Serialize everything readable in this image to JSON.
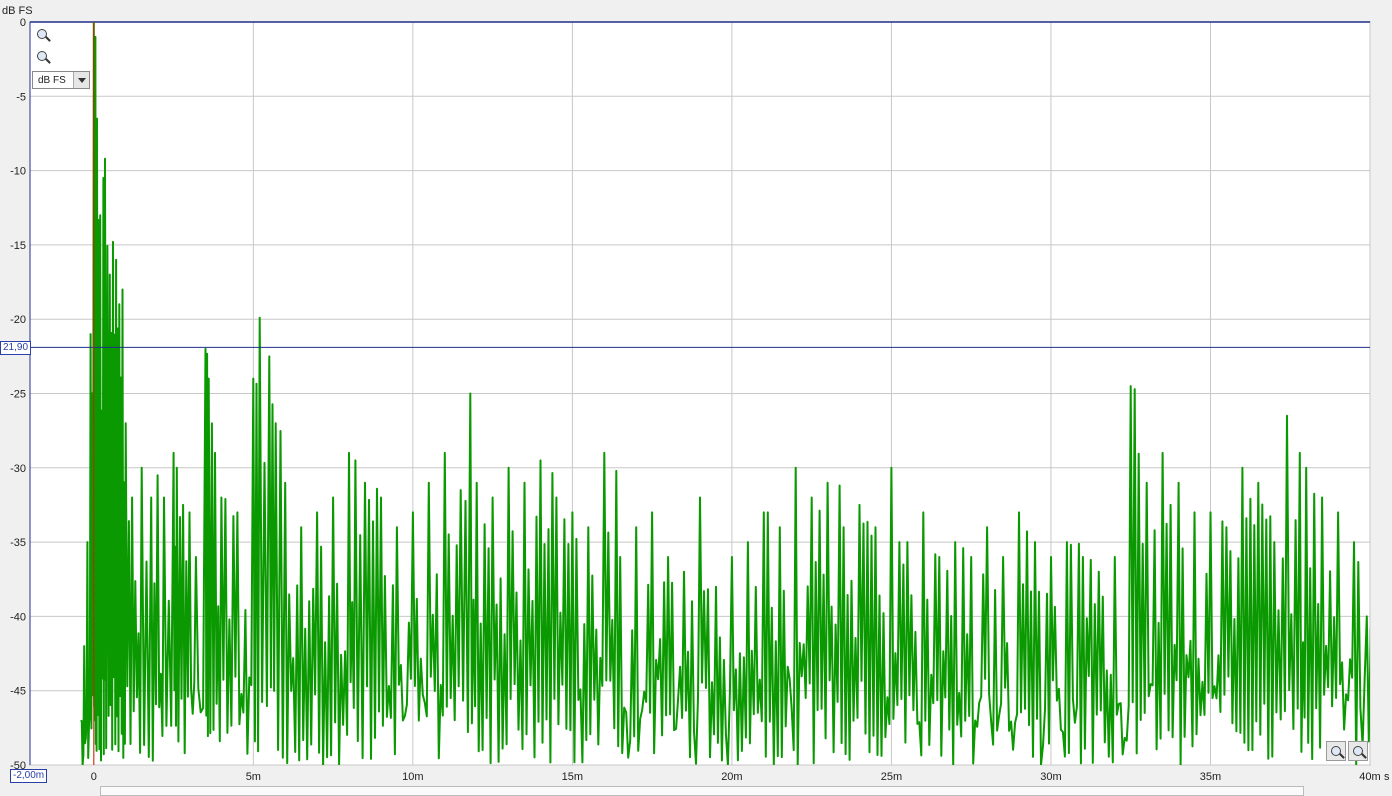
{
  "y_unit_label": "dB FS",
  "x_unit_label": "s",
  "unit_select": {
    "value": "dB FS"
  },
  "cursor": {
    "y_value": "21,90",
    "x_value": "-2,00m"
  },
  "colors": {
    "trace": "#0a9900",
    "grid": "#c8c8c8",
    "cursor": "#1f2f8c",
    "marker": "#cc2200",
    "background": "#ffffff"
  },
  "icons": {
    "zoom_in": "zoom-in-icon",
    "zoom_out": "zoom-out-icon"
  },
  "chart_data": {
    "type": "line",
    "xlabel": "s",
    "ylabel": "dB FS",
    "xlim": [
      -0.002,
      0.04
    ],
    "ylim": [
      -50,
      0
    ],
    "grid": true,
    "x_ticks": [
      "0",
      "5m",
      "10m",
      "15m",
      "20m",
      "25m",
      "30m",
      "35m",
      "40m"
    ],
    "y_ticks": [
      "0",
      "-5",
      "-10",
      "-15",
      "-20",
      "-25",
      "-30",
      "-35",
      "-40",
      "-45",
      "-50"
    ],
    "cursor_level": -21.9,
    "marker_x": 0.0,
    "series": [
      {
        "peaks": [
          [
            -0.0004,
            -47
          ],
          [
            -0.0003,
            -42
          ],
          [
            -0.0002,
            -35
          ],
          [
            -0.0001,
            -21
          ],
          [
            0.0,
            0
          ],
          [
            5e-05,
            -1
          ],
          [
            0.0001,
            -6.5
          ],
          [
            0.0002,
            -13
          ],
          [
            0.0003,
            -10.5
          ],
          [
            0.00035,
            -9.2
          ],
          [
            0.0005,
            -17
          ],
          [
            0.0006,
            -14.8
          ],
          [
            0.0007,
            -16
          ],
          [
            0.0008,
            -19
          ],
          [
            0.0009,
            -18
          ],
          [
            0.001,
            -27
          ],
          [
            0.0012,
            -32
          ],
          [
            0.0015,
            -30
          ],
          [
            0.0018,
            -32
          ],
          [
            0.002,
            -30.5
          ],
          [
            0.0022,
            -32
          ],
          [
            0.0025,
            -29
          ],
          [
            0.0026,
            -30
          ],
          [
            0.0028,
            -32.5
          ],
          [
            0.003,
            -33
          ],
          [
            0.0032,
            -36
          ],
          [
            0.0035,
            -22
          ],
          [
            0.0036,
            -24
          ],
          [
            0.0038,
            -29
          ],
          [
            0.004,
            -32
          ],
          [
            0.0045,
            -33
          ],
          [
            0.005,
            -24
          ],
          [
            0.0052,
            -19.9
          ],
          [
            0.0055,
            -22.5
          ],
          [
            0.0057,
            -27
          ],
          [
            0.006,
            -31
          ],
          [
            0.0065,
            -34
          ],
          [
            0.007,
            -33
          ],
          [
            0.0075,
            -32
          ],
          [
            0.008,
            -29
          ],
          [
            0.0082,
            -29.5
          ],
          [
            0.0085,
            -31
          ],
          [
            0.009,
            -32
          ],
          [
            0.0095,
            -34
          ],
          [
            0.01,
            -33
          ],
          [
            0.0105,
            -31
          ],
          [
            0.011,
            -29
          ],
          [
            0.0115,
            -31.5
          ],
          [
            0.0118,
            -25
          ],
          [
            0.012,
            -31
          ],
          [
            0.0125,
            -32
          ],
          [
            0.013,
            -30
          ],
          [
            0.0135,
            -31
          ],
          [
            0.014,
            -29.5
          ],
          [
            0.0145,
            -32
          ],
          [
            0.015,
            -33
          ],
          [
            0.0155,
            -34
          ],
          [
            0.016,
            -29
          ],
          [
            0.0165,
            -36
          ],
          [
            0.017,
            -34
          ],
          [
            0.0175,
            -33
          ],
          [
            0.018,
            -36
          ],
          [
            0.0185,
            -37
          ],
          [
            0.019,
            -32
          ],
          [
            0.0195,
            -38
          ],
          [
            0.02,
            -36
          ],
          [
            0.0205,
            -35
          ],
          [
            0.021,
            -33
          ],
          [
            0.0215,
            -34
          ],
          [
            0.022,
            -30
          ],
          [
            0.0225,
            -32
          ],
          [
            0.023,
            -31
          ],
          [
            0.0235,
            -34
          ],
          [
            0.024,
            -32.5
          ],
          [
            0.0245,
            -34
          ],
          [
            0.025,
            -30
          ],
          [
            0.0255,
            -35
          ],
          [
            0.026,
            -33
          ],
          [
            0.0265,
            -36
          ],
          [
            0.027,
            -35
          ],
          [
            0.0275,
            -36
          ],
          [
            0.028,
            -34
          ],
          [
            0.0285,
            -36
          ],
          [
            0.029,
            -33
          ],
          [
            0.0295,
            -35
          ],
          [
            0.03,
            -36
          ],
          [
            0.0305,
            -35
          ],
          [
            0.031,
            -36
          ],
          [
            0.0315,
            -37
          ],
          [
            0.032,
            -36
          ],
          [
            0.0325,
            -24.5
          ],
          [
            0.033,
            -31
          ],
          [
            0.0335,
            -29
          ],
          [
            0.034,
            -31
          ],
          [
            0.0345,
            -33
          ],
          [
            0.035,
            -33
          ],
          [
            0.0355,
            -34
          ],
          [
            0.036,
            -30
          ],
          [
            0.0365,
            -31
          ],
          [
            0.037,
            -35
          ],
          [
            0.0374,
            -26.5
          ],
          [
            0.0378,
            -29
          ],
          [
            0.038,
            -30
          ],
          [
            0.0385,
            -32
          ],
          [
            0.039,
            -33
          ],
          [
            0.0395,
            -35
          ],
          [
            0.0399,
            -40
          ]
        ]
      }
    ]
  }
}
